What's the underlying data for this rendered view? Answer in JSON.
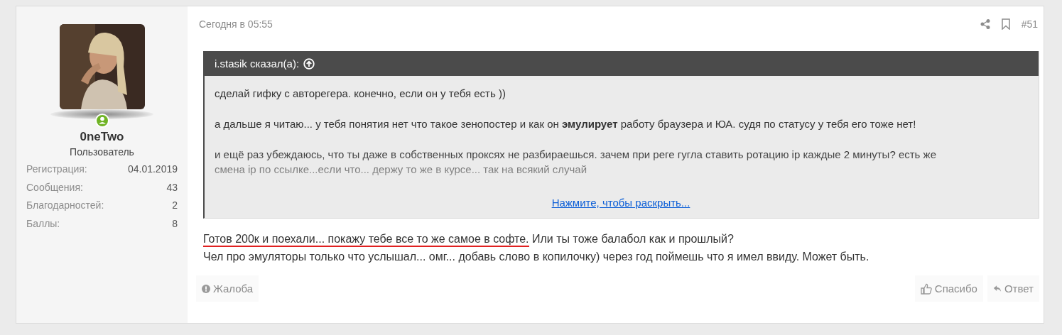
{
  "user": {
    "online": true,
    "name": "0neTwo",
    "role": "Пользователь",
    "stats": [
      {
        "label": "Регистрация:",
        "value": "04.01.2019"
      },
      {
        "label": "Сообщения:",
        "value": "43"
      },
      {
        "label": "Благодарностей:",
        "value": "2"
      },
      {
        "label": "Баллы:",
        "value": "8"
      }
    ]
  },
  "post": {
    "date": "Сегодня в 05:55",
    "number": "#51",
    "quote": {
      "author": "i.stasik сказал(а):",
      "paragraphs": [
        "сделай гифку с авторегера. конечно, если он у тебя есть ))",
        "а дальше я читаю... у тебя понятия нет что такое зенопостер и как он **эмулирует** работу браузера и ЮА. судя по статусу у тебя его тоже нет!",
        "и ещё раз убеждаюсь, что ты даже в собственных проксях не разбираешься. зачем при реге гугла ставить ротацию ip каждые 2 минуты? есть же смена ip по ссылке...если что... держу то же в курсе... так на всякий случай"
      ],
      "expand_link": "Нажмите, чтобы раскрыть..."
    },
    "lines": [
      {
        "segments": [
          {
            "text": "Готов 200к и поехали... покажу тебе все то же самое в софте.",
            "underlined": true
          },
          {
            "text": " Или ты тоже балабол как и прошлый?",
            "underlined": false
          }
        ]
      },
      {
        "segments": [
          {
            "text": "Чел про эмуляторы только что услышал... омг... добавь слово в копилочку) через год поймешь что я имел ввиду. Может быть.",
            "underlined": false
          }
        ]
      }
    ],
    "actions_left": [
      {
        "kind": "report",
        "label": "Жалоба"
      }
    ],
    "actions_right": [
      {
        "kind": "like",
        "label": "Спасибо"
      },
      {
        "kind": "reply",
        "label": "Ответ"
      }
    ]
  }
}
